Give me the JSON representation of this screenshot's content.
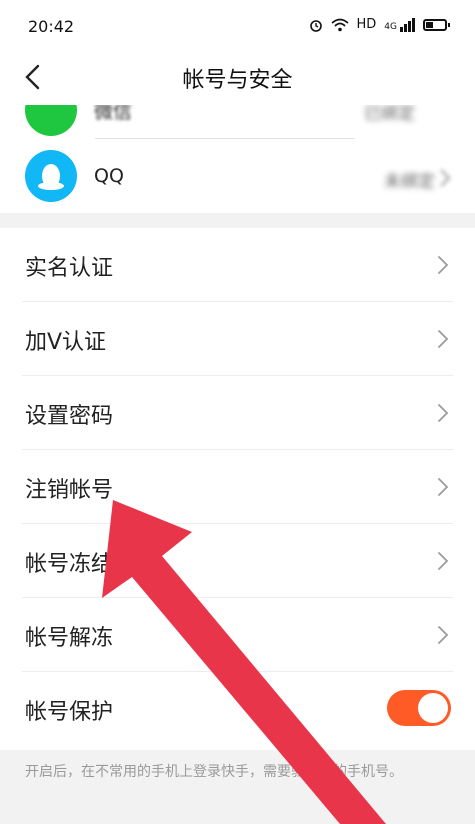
{
  "status_bar": {
    "time": "20:42",
    "network_label": "HD",
    "signal_label": "4G",
    "icons": [
      "alarm-icon",
      "wifi-icon",
      "signal-icon",
      "battery-icon"
    ]
  },
  "nav": {
    "title": "帐号与安全",
    "back_icon": "chevron-left-icon"
  },
  "social_accounts": [
    {
      "name": "微信",
      "value": "已绑定",
      "avatar_color": "#1fc740",
      "icon": "wechat-icon"
    },
    {
      "name": "QQ",
      "value": "未绑定",
      "avatar_color": "#12b7f5",
      "icon": "qq-penguin-icon"
    }
  ],
  "menu_items": [
    {
      "label": "实名认证",
      "control": "chevron"
    },
    {
      "label": "加V认证",
      "control": "chevron"
    },
    {
      "label": "设置密码",
      "control": "chevron"
    },
    {
      "label": "注销帐号",
      "control": "chevron"
    },
    {
      "label": "帐号冻结",
      "control": "chevron"
    },
    {
      "label": "帐号解冻",
      "control": "chevron"
    },
    {
      "label": "帐号保护",
      "control": "toggle",
      "enabled": true
    }
  ],
  "footer_note": "开启后，在不常用的手机上登录快手，需要验证你的手机号。",
  "colors": {
    "toggle_on": "#fe5b26",
    "arrow_annotation": "#e8354a",
    "wechat_green": "#1fc740",
    "qq_blue": "#12b7f5"
  }
}
